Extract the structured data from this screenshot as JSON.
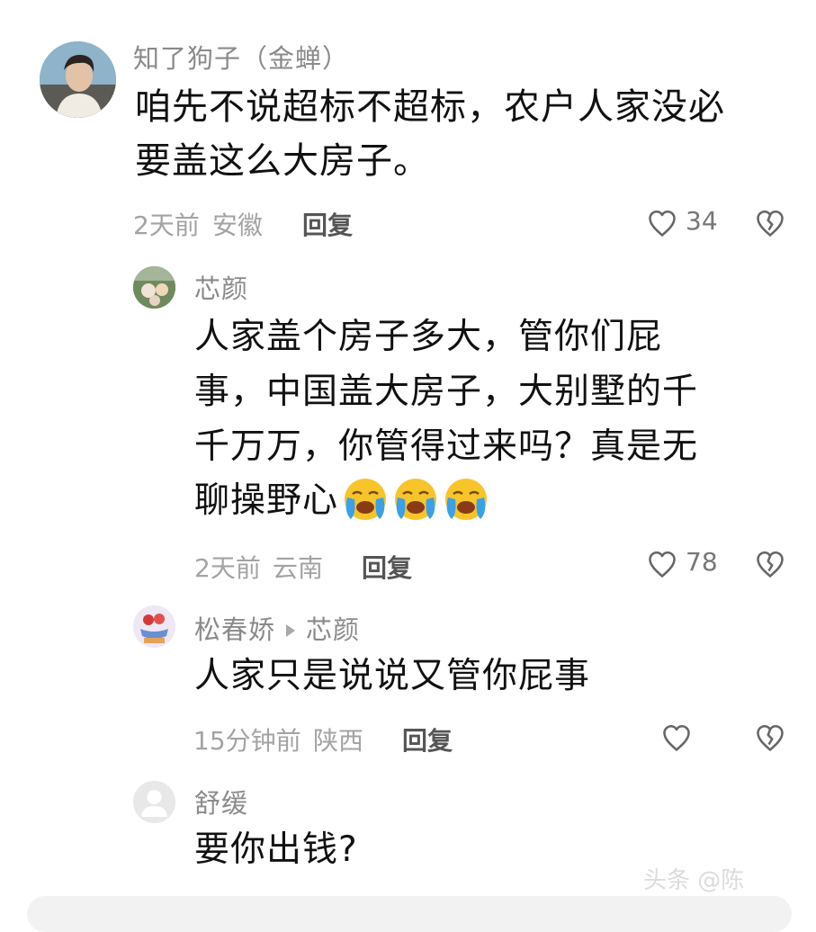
{
  "comments": [
    {
      "author": "知了狗子（金蝉）",
      "lines": [
        "咱先不说超标不超标，农户人家没必",
        "要盖这么大房子。"
      ],
      "time": "2天前",
      "location": "安徽",
      "reply_label": "回复",
      "likes": "34"
    },
    {
      "author": "芯颜",
      "lines": [
        "人家盖个房子多大，管你们屁",
        "事，中国盖大房子，大别墅的千",
        "千万万，你管得过来吗？真是无",
        "聊操野心"
      ],
      "emoji_icons": [
        "loudly-crying-face-icon",
        "loudly-crying-face-icon",
        "loudly-crying-face-icon"
      ],
      "time": "2天前",
      "location": "云南",
      "reply_label": "回复",
      "likes": "78"
    },
    {
      "author": "松春娇",
      "reply_to": "芯颜",
      "lines": [
        "人家只是说说又管你屁事"
      ],
      "time": "15分钟前",
      "location": "陕西",
      "reply_label": "回复",
      "likes": ""
    },
    {
      "author": "舒缓",
      "lines": [
        "要你出钱?"
      ]
    }
  ],
  "icons": {
    "like": "heart-outline-icon",
    "dislike": "broken-heart-icon",
    "default_avatar": "default-avatar-icon"
  },
  "watermark": "头条 @陈"
}
